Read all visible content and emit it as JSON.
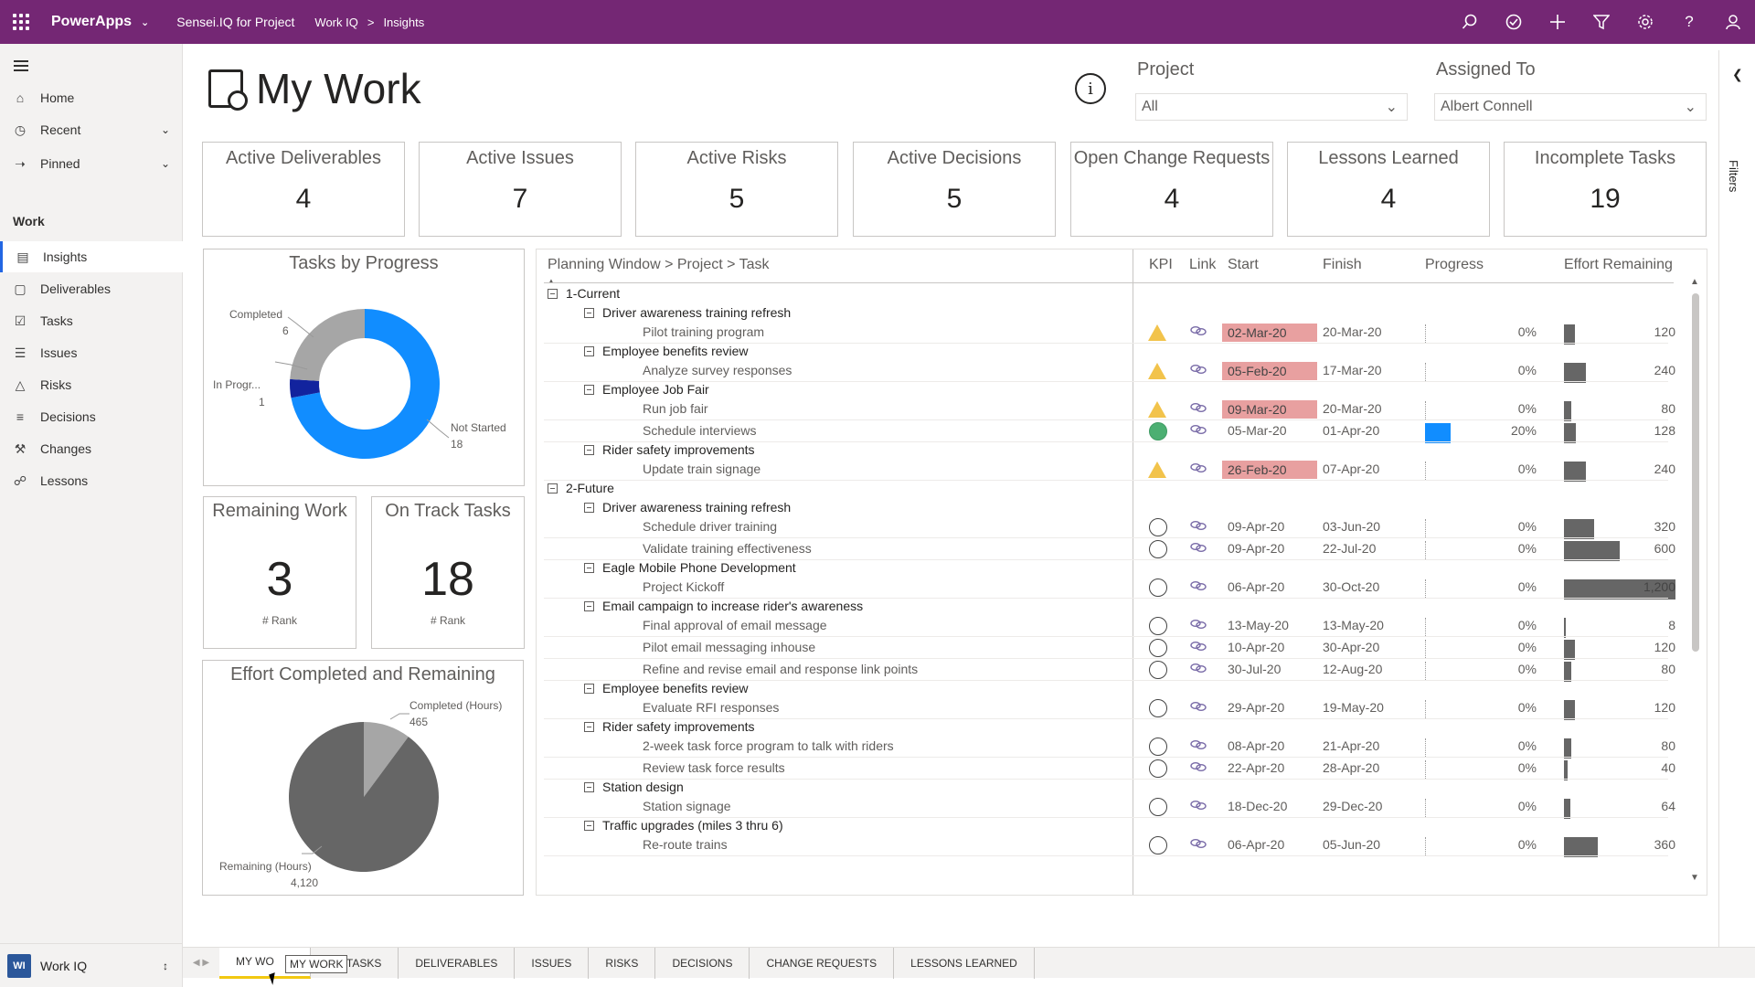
{
  "topbar": {
    "brand": "PowerApps",
    "app_name": "Sensei.IQ for Project",
    "breadcrumb_1": "Work IQ",
    "breadcrumb_sep": ">",
    "breadcrumb_2": "Insights",
    "icons": [
      "search-icon",
      "task-check-icon",
      "plus-icon",
      "filter-icon",
      "gear-icon",
      "help-icon",
      "person-icon"
    ]
  },
  "nav": {
    "items": [
      {
        "label": "Home",
        "icon": "home-icon"
      },
      {
        "label": "Recent",
        "icon": "clock-icon"
      },
      {
        "label": "Pinned",
        "icon": "pin-icon"
      }
    ],
    "section": "Work",
    "work_items": [
      {
        "label": "Insights",
        "icon": "chart-icon",
        "active": true
      },
      {
        "label": "Deliverables",
        "icon": "cube-icon"
      },
      {
        "label": "Tasks",
        "icon": "checkbox-icon"
      },
      {
        "label": "Issues",
        "icon": "list-icon"
      },
      {
        "label": "Risks",
        "icon": "warning-icon"
      },
      {
        "label": "Decisions",
        "icon": "decision-icon"
      },
      {
        "label": "Changes",
        "icon": "wrench-icon"
      },
      {
        "label": "Lessons",
        "icon": "lesson-icon"
      }
    ],
    "footer_badge": "WI",
    "footer_label": "Work IQ"
  },
  "page": {
    "title": "My Work",
    "info": "i",
    "project_label": "Project",
    "project_value": "All",
    "assigned_label": "Assigned To",
    "assigned_value": "Albert Connell",
    "filters_label": "Filters"
  },
  "kpis": [
    {
      "title": "Active Deliverables",
      "value": "4"
    },
    {
      "title": "Active Issues",
      "value": "7"
    },
    {
      "title": "Active Risks",
      "value": "5"
    },
    {
      "title": "Active Decisions",
      "value": "5"
    },
    {
      "title": "Open Change Requests",
      "value": "4"
    },
    {
      "title": "Lessons Learned",
      "value": "4"
    },
    {
      "title": "Incomplete Tasks",
      "value": "19"
    }
  ],
  "tasks_by_progress": {
    "title": "Tasks by Progress",
    "completed_label": "Completed",
    "completed_value": "6",
    "inprog_label": "In Progr...",
    "inprog_value": "1",
    "notstarted_label": "Not Started",
    "notstarted_value": "18",
    "colors": {
      "completed": "#a6a6a6",
      "inprog": "#12239e",
      "notstarted": "#118dff"
    }
  },
  "remaining_work": {
    "title": "Remaining Work",
    "value": "3",
    "sub": "# Rank"
  },
  "on_track": {
    "title": "On Track Tasks",
    "value": "18",
    "sub": "# Rank"
  },
  "effort": {
    "title": "Effort Completed and Remaining",
    "completed_label": "Completed (Hours)",
    "completed_value": "465",
    "remaining_label": "Remaining (Hours)",
    "remaining_value": "4,120"
  },
  "matrix": {
    "headers": {
      "hierarchy": "Planning Window > Project > Task",
      "kpi": "KPI",
      "link": "Link",
      "start": "Start",
      "finish": "Finish",
      "progress": "Progress",
      "effort": "Effort Remaining"
    },
    "rows": [
      {
        "level": 0,
        "name": "1-Current"
      },
      {
        "level": 1,
        "name": "Driver awareness training refresh"
      },
      {
        "level": 2,
        "name": "Pilot training program",
        "kpi": "triangle",
        "start": "02-Mar-20",
        "late": true,
        "finish": "20-Mar-20",
        "progress": 0,
        "progress_label": "0%",
        "effort": 120,
        "effort_label": "120"
      },
      {
        "level": 1,
        "name": "Employee benefits review"
      },
      {
        "level": 2,
        "name": "Analyze survey responses",
        "kpi": "triangle",
        "start": "05-Feb-20",
        "late": true,
        "finish": "17-Mar-20",
        "progress": 0,
        "progress_label": "0%",
        "effort": 240,
        "effort_label": "240"
      },
      {
        "level": 1,
        "name": "Employee Job Fair"
      },
      {
        "level": 2,
        "name": "Run job fair",
        "kpi": "triangle",
        "start": "09-Mar-20",
        "late": true,
        "finish": "20-Mar-20",
        "progress": 0,
        "progress_label": "0%",
        "effort": 80,
        "effort_label": "80"
      },
      {
        "level": 2,
        "name": "Schedule interviews",
        "kpi": "green",
        "start": "05-Mar-20",
        "late": false,
        "finish": "01-Apr-20",
        "progress": 20,
        "progress_label": "20%",
        "effort": 128,
        "effort_label": "128"
      },
      {
        "level": 1,
        "name": "Rider safety improvements"
      },
      {
        "level": 2,
        "name": "Update train signage",
        "kpi": "triangle",
        "start": "26-Feb-20",
        "late": true,
        "finish": "07-Apr-20",
        "progress": 0,
        "progress_label": "0%",
        "effort": 240,
        "effort_label": "240"
      },
      {
        "level": 0,
        "name": "2-Future"
      },
      {
        "level": 1,
        "name": "Driver awareness training refresh"
      },
      {
        "level": 2,
        "name": "Schedule driver training",
        "kpi": "circle",
        "start": "09-Apr-20",
        "late": false,
        "finish": "03-Jun-20",
        "progress": 0,
        "progress_label": "0%",
        "effort": 320,
        "effort_label": "320"
      },
      {
        "level": 2,
        "name": "Validate training effectiveness",
        "kpi": "circle",
        "start": "09-Apr-20",
        "late": false,
        "finish": "22-Jul-20",
        "progress": 0,
        "progress_label": "0%",
        "effort": 600,
        "effort_label": "600"
      },
      {
        "level": 1,
        "name": "Eagle Mobile Phone Development"
      },
      {
        "level": 2,
        "name": "Project Kickoff",
        "kpi": "circle",
        "start": "06-Apr-20",
        "late": false,
        "finish": "30-Oct-20",
        "progress": 0,
        "progress_label": "0%",
        "effort": 1200,
        "effort_label": "1,200"
      },
      {
        "level": 1,
        "name": "Email campaign to increase rider's awareness"
      },
      {
        "level": 2,
        "name": "Final approval of email message",
        "kpi": "circle",
        "start": "13-May-20",
        "late": false,
        "finish": "13-May-20",
        "progress": 0,
        "progress_label": "0%",
        "effort": 8,
        "effort_label": "8"
      },
      {
        "level": 2,
        "name": "Pilot email messaging inhouse",
        "kpi": "circle",
        "start": "10-Apr-20",
        "late": false,
        "finish": "30-Apr-20",
        "progress": 0,
        "progress_label": "0%",
        "effort": 120,
        "effort_label": "120"
      },
      {
        "level": 2,
        "name": "Refine and revise email and response link points",
        "kpi": "circle",
        "start": "30-Jul-20",
        "late": false,
        "finish": "12-Aug-20",
        "progress": 0,
        "progress_label": "0%",
        "effort": 80,
        "effort_label": "80"
      },
      {
        "level": 1,
        "name": "Employee benefits review"
      },
      {
        "level": 2,
        "name": "Evaluate RFI responses",
        "kpi": "circle",
        "start": "29-Apr-20",
        "late": false,
        "finish": "19-May-20",
        "progress": 0,
        "progress_label": "0%",
        "effort": 120,
        "effort_label": "120"
      },
      {
        "level": 1,
        "name": "Rider safety improvements"
      },
      {
        "level": 2,
        "name": "2-week task force program to talk with riders",
        "kpi": "circle",
        "start": "08-Apr-20",
        "late": false,
        "finish": "21-Apr-20",
        "progress": 0,
        "progress_label": "0%",
        "effort": 80,
        "effort_label": "80"
      },
      {
        "level": 2,
        "name": "Review task force results",
        "kpi": "circle",
        "start": "22-Apr-20",
        "late": false,
        "finish": "28-Apr-20",
        "progress": 0,
        "progress_label": "0%",
        "effort": 40,
        "effort_label": "40"
      },
      {
        "level": 1,
        "name": "Station design"
      },
      {
        "level": 2,
        "name": "Station signage",
        "kpi": "circle",
        "start": "18-Dec-20",
        "late": false,
        "finish": "29-Dec-20",
        "progress": 0,
        "progress_label": "0%",
        "effort": 64,
        "effort_label": "64"
      },
      {
        "level": 1,
        "name": "Traffic upgrades (miles 3 thru 6)"
      },
      {
        "level": 2,
        "name": "Re-route trains",
        "kpi": "circle",
        "start": "06-Apr-20",
        "late": false,
        "finish": "05-Jun-20",
        "progress": 0,
        "progress_label": "0%",
        "effort": 360,
        "effort_label": "360"
      }
    ]
  },
  "tabs": {
    "items": [
      "MY WORK",
      "MY TASKS",
      "DELIVERABLES",
      "ISSUES",
      "RISKS",
      "DECISIONS",
      "CHANGE REQUESTS",
      "LESSONS LEARNED"
    ],
    "active": 0,
    "first_visible": "MY WO",
    "second_visible": "Y TASKS",
    "tooltip": "MY WORK"
  }
}
